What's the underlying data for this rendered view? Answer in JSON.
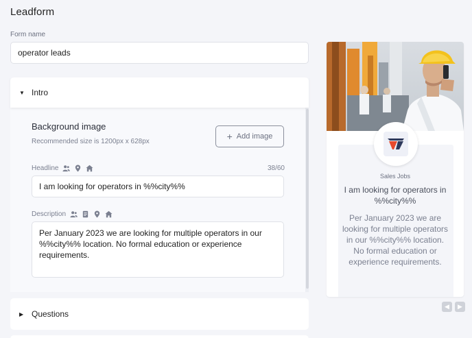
{
  "page": {
    "title": "Leadform"
  },
  "form_name": {
    "label": "Form name",
    "value": "operator leads"
  },
  "intro": {
    "title": "Intro",
    "background_image": {
      "title": "Background image",
      "hint": "Recommended size is 1200px x 628px",
      "add_label": "Add image"
    },
    "headline": {
      "label": "Headline",
      "counter": "38/60",
      "value": "I am looking for operators in %%city%%"
    },
    "description": {
      "label": "Description",
      "value": "Per January 2023 we are looking for multiple operators in our %%city%% location. No formal education or experience requirements."
    }
  },
  "questions": {
    "title": "Questions"
  },
  "preview": {
    "company": "Sales Jobs",
    "headline": "I am looking for operators in %%city%%",
    "description": "Per January 2023 we are looking for multiple operators in our %%city%% location. No formal education or experience requirements."
  },
  "icons": [
    "caret-down-icon",
    "caret-right-icon",
    "plus-icon",
    "users-icon",
    "location-pin-icon",
    "home-icon",
    "document-icon",
    "arrow-left-icon",
    "arrow-right-icon"
  ],
  "colors": {
    "background": "#f4f5f9",
    "card": "#ffffff",
    "text": "#2b2f3a",
    "muted": "#7b8090"
  }
}
